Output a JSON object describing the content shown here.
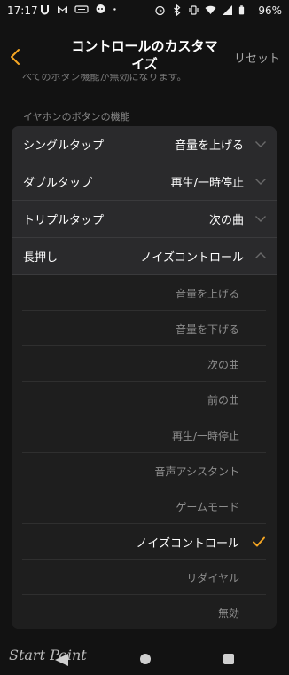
{
  "status_bar": {
    "time": "17:17",
    "battery": "96%",
    "left_icons": [
      "u-app-icon",
      "gmail-icon",
      "nfc-pay-icon",
      "chat-icon",
      "dot-icon"
    ],
    "right_icons": [
      "alarm-icon",
      "bluetooth-icon",
      "vibrate-icon",
      "wifi-icon",
      "signal-icon",
      "battery-icon"
    ]
  },
  "header": {
    "title_line1": "コントロールのカスタマ",
    "title_line2": "イズ",
    "reset_label": "リセット"
  },
  "partial_text": "べてのボタン機能が無効になります。",
  "section_label": "イヤホンのボタンの機能",
  "rows": [
    {
      "label": "シングルタップ",
      "value": "音量を上げる"
    },
    {
      "label": "ダブルタップ",
      "value": "再生/一時停止"
    },
    {
      "label": "トリプルタップ",
      "value": "次の曲"
    },
    {
      "label": "長押し",
      "value": "ノイズコントロール"
    }
  ],
  "options": [
    {
      "label": "音量を上げる",
      "selected": false
    },
    {
      "label": "音量を下げる",
      "selected": false
    },
    {
      "label": "次の曲",
      "selected": false
    },
    {
      "label": "前の曲",
      "selected": false
    },
    {
      "label": "再生/一時停止",
      "selected": false
    },
    {
      "label": "音声アシスタント",
      "selected": false
    },
    {
      "label": "ゲームモード",
      "selected": false
    },
    {
      "label": "ノイズコントロール",
      "selected": true
    },
    {
      "label": "リダイヤル",
      "selected": false
    },
    {
      "label": "無効",
      "selected": false
    }
  ],
  "nav": {
    "watermark": "Start Point"
  },
  "colors": {
    "accent": "#f5a623",
    "background": "#121212",
    "card": "#2a2a2c",
    "expanded_list": "#1e1e1e"
  }
}
